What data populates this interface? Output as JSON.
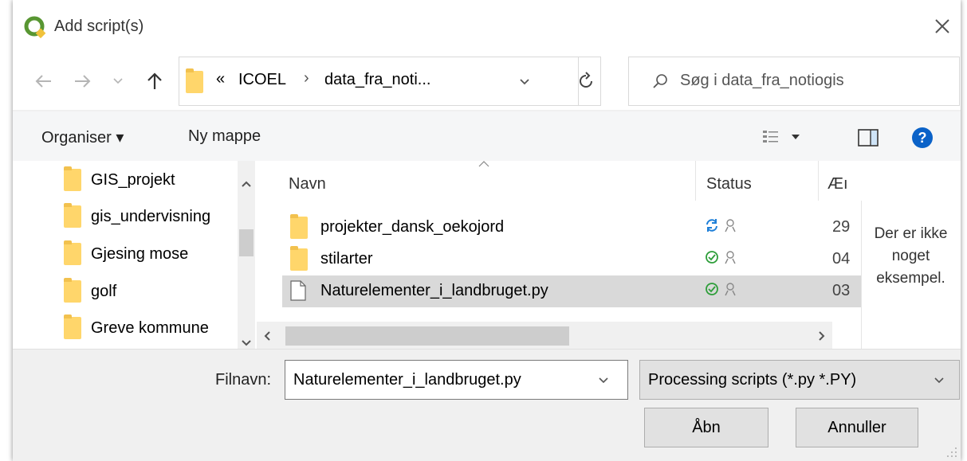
{
  "window": {
    "title": "Add script(s)"
  },
  "address": {
    "overflow": "«",
    "crumbs": [
      "ICOEL",
      "data_fra_noti..."
    ],
    "sep": "›"
  },
  "search": {
    "placeholder": "Søg i data_fra_notiogis"
  },
  "toolbar": {
    "organise": "Organiser ▾",
    "new_folder": "Ny mappe"
  },
  "nav": {
    "items": [
      "GIS_projekt",
      "gis_undervisning",
      "Gjesing mose",
      "golf",
      "Greve kommune"
    ]
  },
  "columns": {
    "name": "Navn",
    "status": "Status",
    "date": "Æı"
  },
  "files": [
    {
      "name": "projekter_dansk_oekojord",
      "date": "29",
      "type": "folder",
      "status": "sync"
    },
    {
      "name": "stilarter",
      "date": "04",
      "type": "folder",
      "status": "ok"
    },
    {
      "name": "Naturelementer_i_landbruget.py",
      "date": "03",
      "type": "file",
      "status": "ok",
      "selected": true
    }
  ],
  "preview": {
    "line1": "Der er ikke",
    "line2": "noget",
    "line3": "eksempel."
  },
  "bottom": {
    "filename_label": "Filnavn:",
    "filename_value": "Naturelementer_i_landbruget.py",
    "filter_value": "Processing scripts (*.py *.PY)",
    "open_label": "Åbn",
    "cancel_label": "Annuller"
  },
  "colors": {
    "accent": "#0a78d7",
    "sync": "#1e7fd8",
    "ok": "#2e9e3a",
    "folder": "#ffd66b",
    "qgis": "#589632"
  }
}
